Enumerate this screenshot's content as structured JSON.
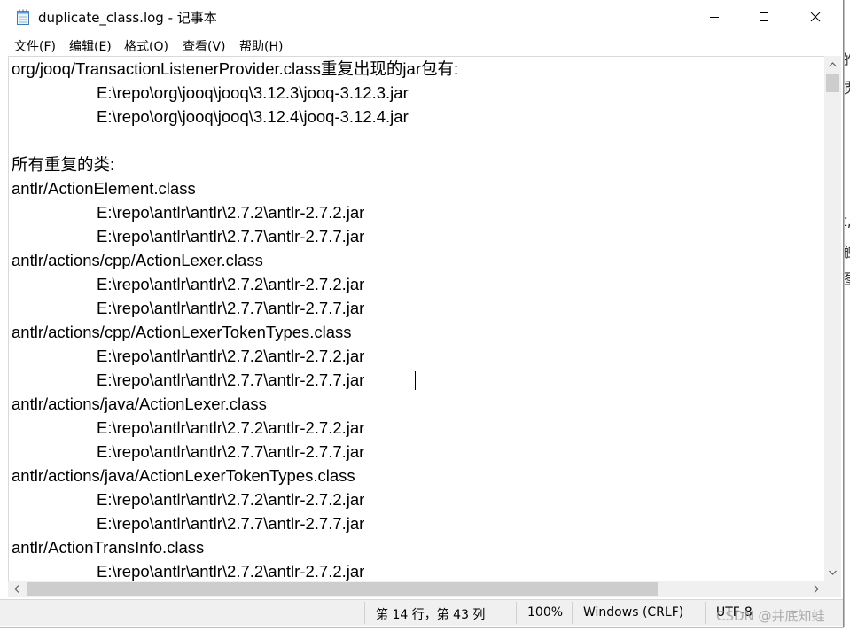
{
  "window": {
    "title": "duplicate_class.log - 记事本",
    "controls": {
      "minimize": "minimize",
      "maximize": "maximize",
      "close": "close"
    }
  },
  "menu": [
    {
      "label": "文件(F)"
    },
    {
      "label": "编辑(E)"
    },
    {
      "label": "格式(O)"
    },
    {
      "label": "查看(V)"
    },
    {
      "label": "帮助(H)"
    }
  ],
  "editor": {
    "lines": [
      {
        "text": "org/jooq/TransactionListenerProvider.class重复出现的jar包有:",
        "indent": false
      },
      {
        "text": "E:\\repo\\org\\jooq\\jooq\\3.12.3\\jooq-3.12.3.jar",
        "indent": true
      },
      {
        "text": "E:\\repo\\org\\jooq\\jooq\\3.12.4\\jooq-3.12.4.jar",
        "indent": true
      },
      {
        "text": "",
        "indent": false
      },
      {
        "text": "所有重复的类:",
        "indent": false
      },
      {
        "text": "antlr/ActionElement.class",
        "indent": false
      },
      {
        "text": "E:\\repo\\antlr\\antlr\\2.7.2\\antlr-2.7.2.jar",
        "indent": true
      },
      {
        "text": "E:\\repo\\antlr\\antlr\\2.7.7\\antlr-2.7.7.jar",
        "indent": true
      },
      {
        "text": "antlr/actions/cpp/ActionLexer.class",
        "indent": false
      },
      {
        "text": "E:\\repo\\antlr\\antlr\\2.7.2\\antlr-2.7.2.jar",
        "indent": true
      },
      {
        "text": "E:\\repo\\antlr\\antlr\\2.7.7\\antlr-2.7.7.jar",
        "indent": true
      },
      {
        "text": "antlr/actions/cpp/ActionLexerTokenTypes.class",
        "indent": false
      },
      {
        "text": "E:\\repo\\antlr\\antlr\\2.7.2\\antlr-2.7.2.jar",
        "indent": true
      },
      {
        "text": "E:\\repo\\antlr\\antlr\\2.7.7\\antlr-2.7.7.jar",
        "indent": true
      },
      {
        "text": "antlr/actions/java/ActionLexer.class",
        "indent": false
      },
      {
        "text": "E:\\repo\\antlr\\antlr\\2.7.2\\antlr-2.7.2.jar",
        "indent": true
      },
      {
        "text": "E:\\repo\\antlr\\antlr\\2.7.7\\antlr-2.7.7.jar",
        "indent": true
      },
      {
        "text": "antlr/actions/java/ActionLexerTokenTypes.class",
        "indent": false
      },
      {
        "text": "E:\\repo\\antlr\\antlr\\2.7.2\\antlr-2.7.2.jar",
        "indent": true
      },
      {
        "text": "E:\\repo\\antlr\\antlr\\2.7.7\\antlr-2.7.7.jar",
        "indent": true
      },
      {
        "text": "antlr/ActionTransInfo.class",
        "indent": false
      },
      {
        "text": "E:\\repo\\antlr\\antlr\\2.7.2\\antlr-2.7.2.jar",
        "indent": true
      }
    ]
  },
  "status": {
    "position": "第 14 行，第 43 列",
    "zoom": "100%",
    "line_ending": "Windows (CRLF)",
    "encoding": "UTF-8"
  },
  "watermark": "CSDN @井底知蛙",
  "background_fragments": [
    "的",
    "质",
    "t,",
    "触",
    "图"
  ]
}
